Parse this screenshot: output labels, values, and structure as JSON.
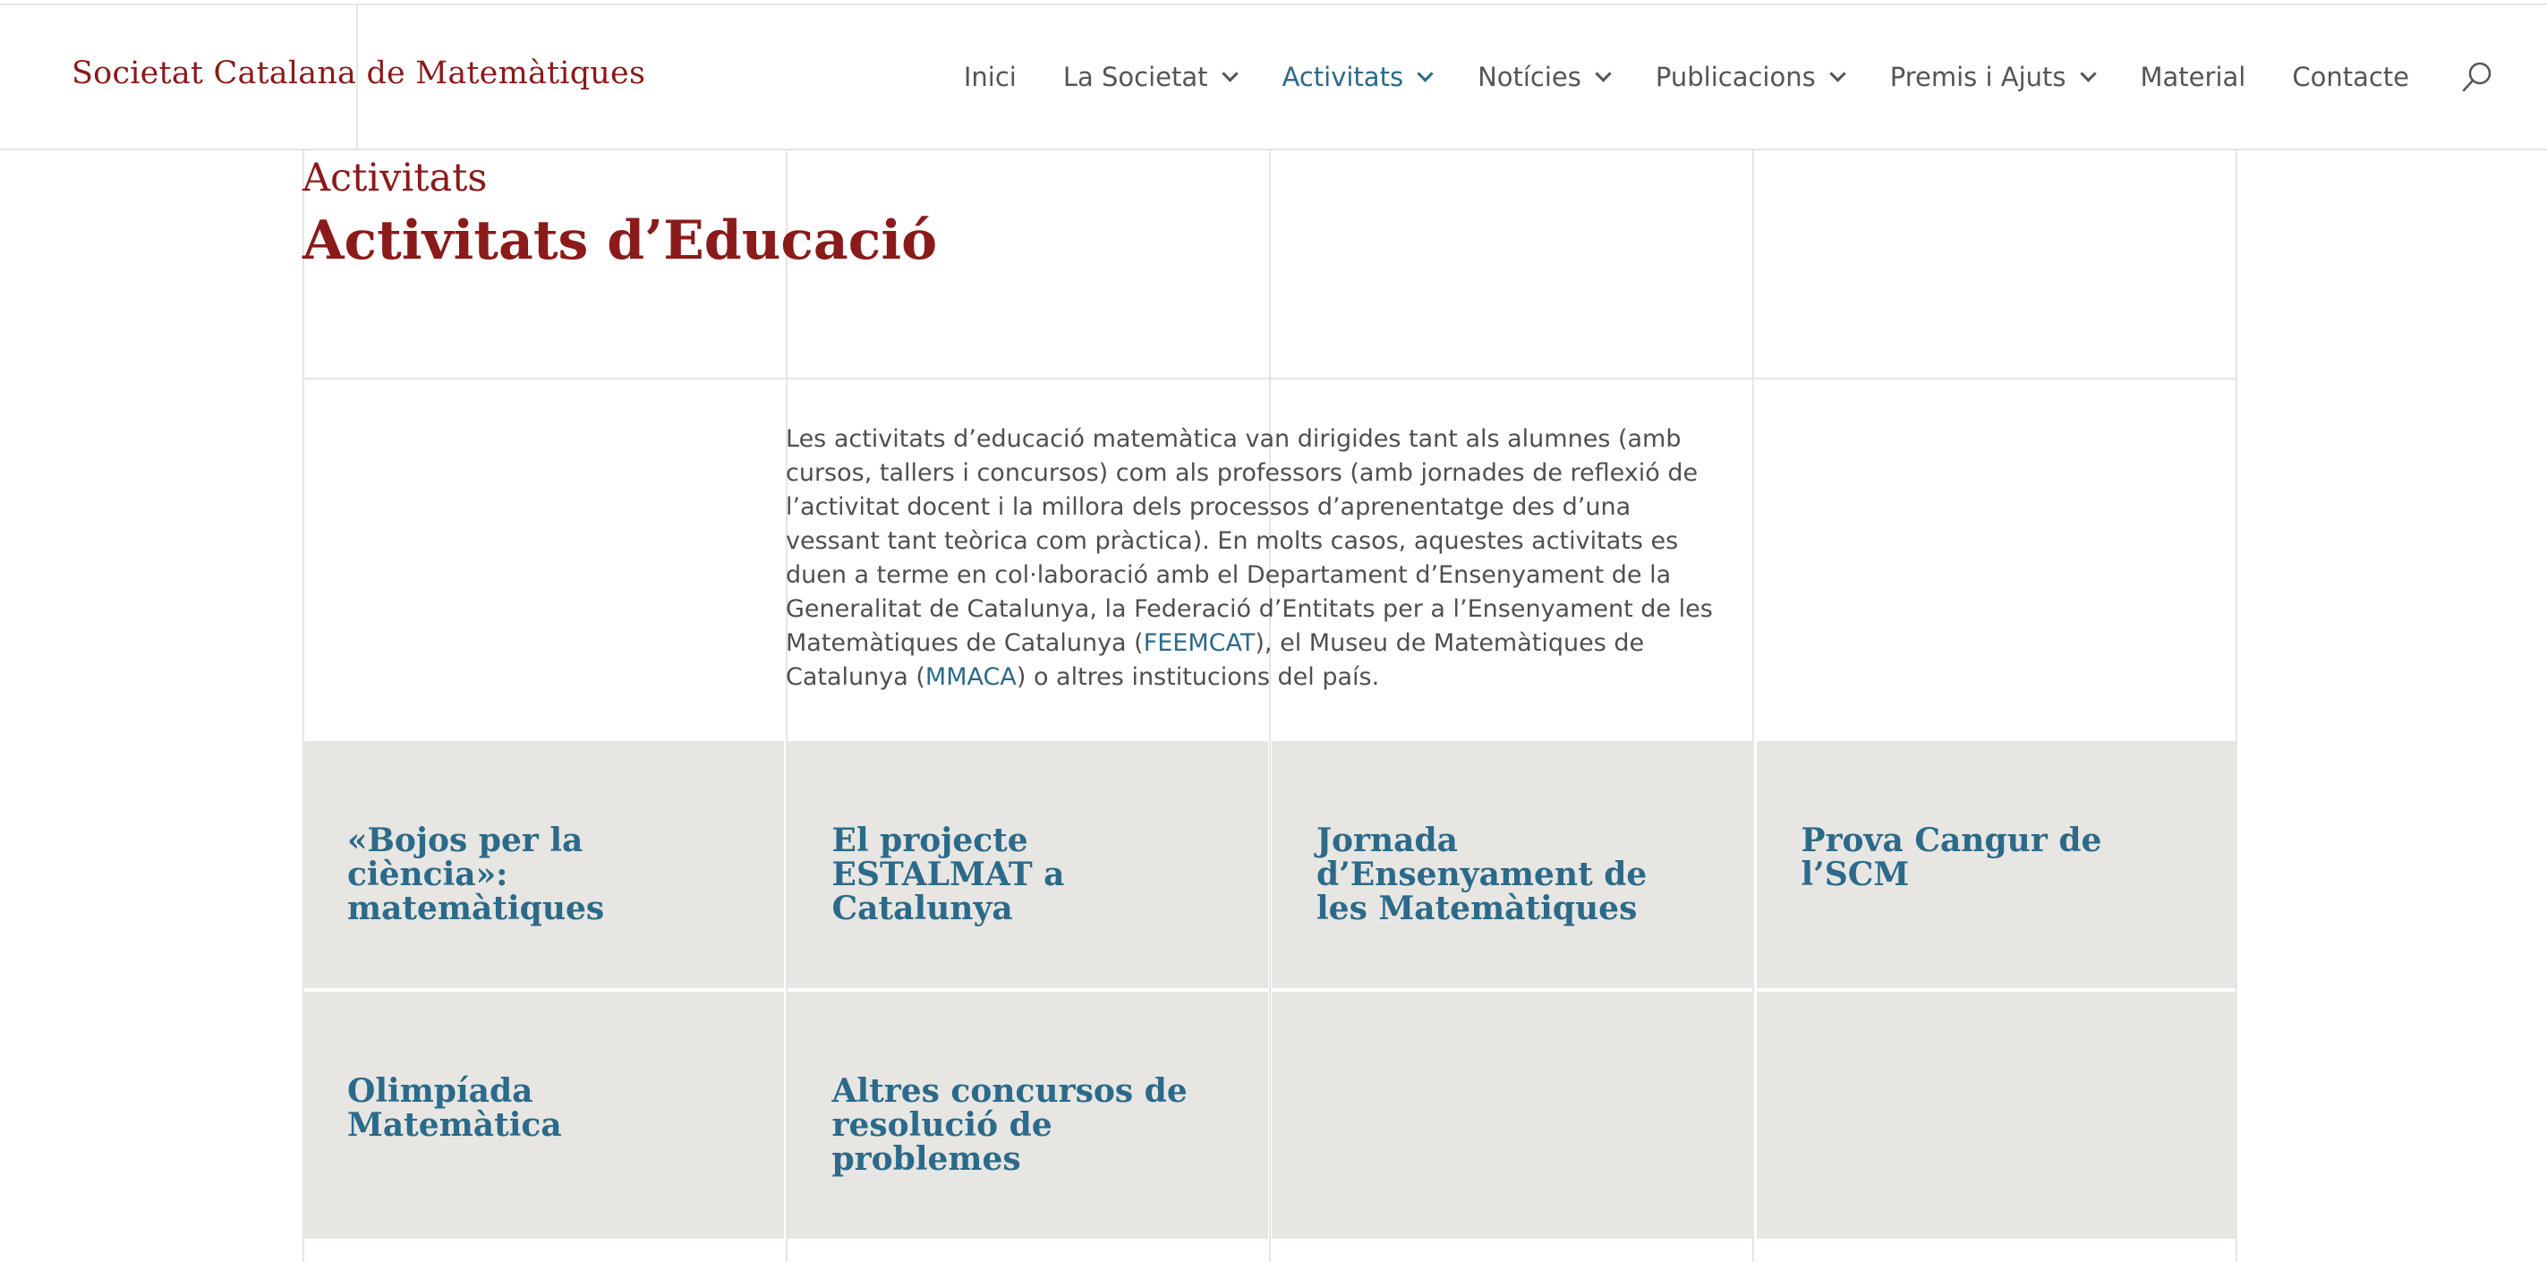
{
  "header": {
    "logo_text": "Societat Catalana de Matemàtiques",
    "nav": [
      {
        "label": "Inici",
        "has_dropdown": false,
        "active": false
      },
      {
        "label": "La Societat",
        "has_dropdown": true,
        "active": false
      },
      {
        "label": "Activitats",
        "has_dropdown": true,
        "active": true
      },
      {
        "label": "Notícies",
        "has_dropdown": true,
        "active": false
      },
      {
        "label": "Publicacions",
        "has_dropdown": true,
        "active": false
      },
      {
        "label": "Premis i Ajuts",
        "has_dropdown": true,
        "active": false
      },
      {
        "label": "Material",
        "has_dropdown": false,
        "active": false
      },
      {
        "label": "Contacte",
        "has_dropdown": false,
        "active": false
      }
    ],
    "search_icon": "search-icon"
  },
  "page": {
    "breadcrumb": "Activitats",
    "title": "Activitats d’Educació"
  },
  "intro": {
    "text_1": "Les activitats d’educació matemàtica van dirigides tant als alumnes (amb cursos, tallers i concursos) com als professors (amb jornades de reflexió de l’activitat docent i la millora dels processos d’aprenentatge des d’una vessant tant teòrica com pràctica). En molts casos, aquestes activitats es duen a terme en col·laboració amb el Departament d’Ensenyament de la Generalitat de Catalunya, la Federació d’Entitats per a l’Ensenyament de les Matemàtiques de Catalunya (",
    "link_1": "FEEMCAT",
    "text_2": "), el Museu de Matemàtiques de Catalunya (",
    "link_2": "MMACA",
    "text_3": ") o altres institucions del país."
  },
  "tiles": [
    {
      "title": "«Bojos per la ciència»: matemàtiques"
    },
    {
      "title": "El projecte ESTALMAT a Catalunya"
    },
    {
      "title": "Jornada d’Ensenyament de les Matemàtiques"
    },
    {
      "title": "Prova Cangur de l’SCM"
    },
    {
      "title": "Olimpíada Matemàtica"
    },
    {
      "title": "Altres concursos de resolució de problemes"
    },
    {
      "title": ""
    },
    {
      "title": ""
    }
  ],
  "colors": {
    "brand": "#8b1a1a",
    "link": "#2b6a8a",
    "tile_bg": "#e7e6e2",
    "text": "#4f4f4f"
  }
}
